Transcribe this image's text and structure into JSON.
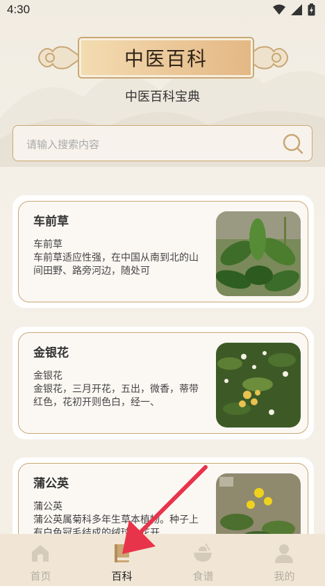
{
  "status": {
    "time": "4:30"
  },
  "header": {
    "title": "中医百科",
    "subtitle": "中医百科宝典"
  },
  "search": {
    "placeholder": "请输入搜索内容"
  },
  "cards": [
    {
      "name": "车前草",
      "desc": "车前草\n车前草适应性强，在中国从南到北的山间田野、路旁河边，随处可"
    },
    {
      "name": "金银花",
      "desc": "金银花\n金银花，三月开花，五出，微香，蒂带红色，花初开则色白，经一、"
    },
    {
      "name": "蒲公英",
      "desc": "蒲公英\n蒲公英属菊科多年生草本植物。种子上有白色冠毛结成的绒球，花开"
    }
  ],
  "tabs": [
    {
      "label": "首页",
      "icon": "home-icon",
      "active": false
    },
    {
      "label": "百科",
      "icon": "book-icon",
      "active": true
    },
    {
      "label": "食谱",
      "icon": "bowl-icon",
      "active": false
    },
    {
      "label": "我的",
      "icon": "user-icon",
      "active": false
    }
  ],
  "colors": {
    "accent": "#c9a673",
    "tabbar": "#f1e6d5",
    "annotation_arrow": "#e8344b"
  }
}
